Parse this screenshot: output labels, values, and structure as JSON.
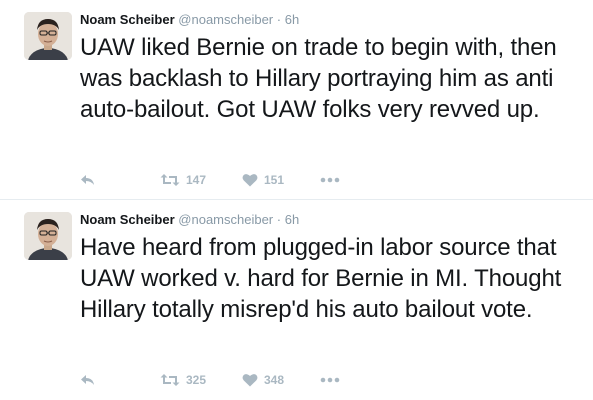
{
  "tweets": [
    {
      "author": {
        "name": "Noam Scheiber",
        "handle": "@noamscheiber"
      },
      "separator": "·",
      "time": "6h",
      "text": "UAW liked Bernie on trade to begin with, then was backlash to Hillary portraying him as anti auto-bailout. Got UAW folks very revved up.",
      "retweets": "147",
      "likes": "151"
    },
    {
      "author": {
        "name": "Noam Scheiber",
        "handle": "@noamscheiber"
      },
      "separator": "·",
      "time": "6h",
      "text": "Have heard from plugged-in labor source that UAW worked v. hard for Bernie in MI. Thought Hillary totally misrep'd his auto bailout vote.",
      "retweets": "325",
      "likes": "348"
    }
  ],
  "icons": {
    "reply": "reply-icon",
    "retweet": "retweet-icon",
    "like": "heart-icon",
    "more": "more-dots-icon"
  },
  "colors": {
    "icon": "#aab8c2",
    "text": "#14171a",
    "meta": "#8899a6"
  }
}
